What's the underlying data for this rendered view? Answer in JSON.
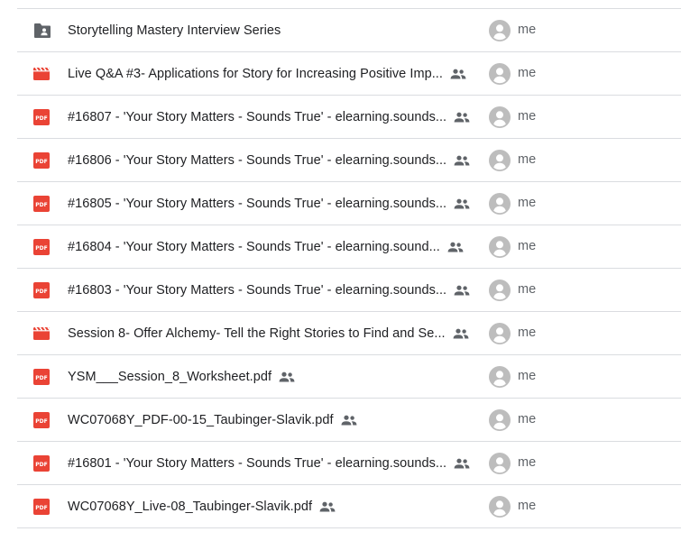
{
  "files": [
    {
      "name": "Storytelling Mastery Interview Series",
      "type_icon": "shared-folder-icon",
      "shared": false,
      "owner": "me"
    },
    {
      "name": "Live Q&A #3- Applications for Story for Increasing Positive Imp...",
      "type_icon": "video-icon",
      "shared": true,
      "owner": "me"
    },
    {
      "name": "#16807 - 'Your Story Matters - Sounds True' - elearning.sounds...",
      "type_icon": "pdf-icon",
      "shared": true,
      "owner": "me"
    },
    {
      "name": "#16806 - 'Your Story Matters - Sounds True' - elearning.sounds...",
      "type_icon": "pdf-icon",
      "shared": true,
      "owner": "me"
    },
    {
      "name": "#16805 - 'Your Story Matters - Sounds True' - elearning.sounds...",
      "type_icon": "pdf-icon",
      "shared": true,
      "owner": "me"
    },
    {
      "name": "#16804 - 'Your Story Matters - Sounds True' - elearning.sound...",
      "type_icon": "pdf-icon",
      "shared": true,
      "owner": "me"
    },
    {
      "name": "#16803 - 'Your Story Matters - Sounds True' - elearning.sounds...",
      "type_icon": "pdf-icon",
      "shared": true,
      "owner": "me"
    },
    {
      "name": "Session 8- Offer Alchemy- Tell the Right Stories to Find and Se...",
      "type_icon": "video-icon",
      "shared": true,
      "owner": "me"
    },
    {
      "name": "YSM___Session_8_Worksheet.pdf",
      "type_icon": "pdf-icon",
      "shared": true,
      "owner": "me"
    },
    {
      "name": "WC07068Y_PDF-00-15_Taubinger-Slavik.pdf",
      "type_icon": "pdf-icon",
      "shared": true,
      "owner": "me"
    },
    {
      "name": "#16801 - 'Your Story Matters - Sounds True' - elearning.sounds...",
      "type_icon": "pdf-icon",
      "shared": true,
      "owner": "me"
    },
    {
      "name": "WC07068Y_Live-08_Taubinger-Slavik.pdf",
      "type_icon": "pdf-icon",
      "shared": true,
      "owner": "me"
    }
  ],
  "colors": {
    "pdf_red": "#ea4335",
    "video_red": "#ea4335",
    "folder_gray": "#5f6368",
    "text": "#202124",
    "secondary_text": "#5f6368",
    "avatar_gray": "#bdbdbd",
    "divider": "#dadce0"
  }
}
